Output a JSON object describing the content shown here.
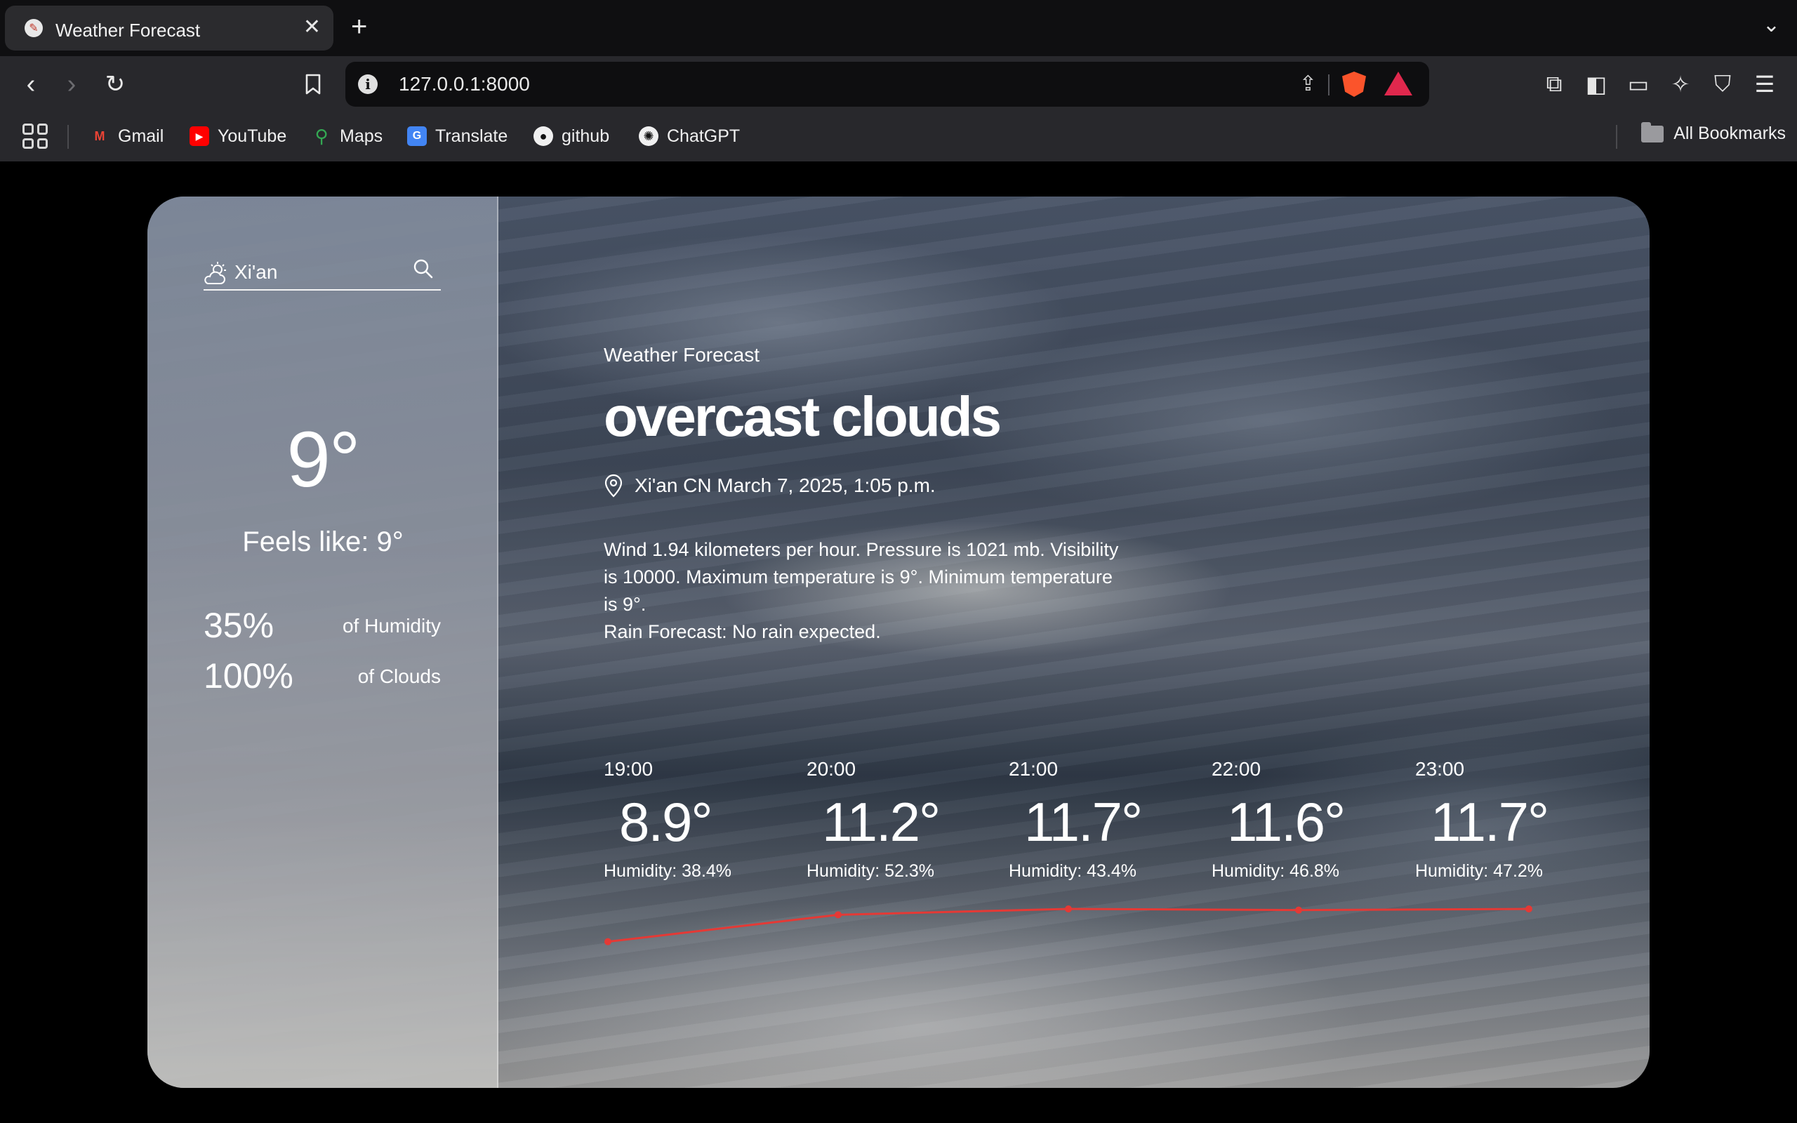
{
  "browser": {
    "tab_title": "Weather Forecast",
    "url": "127.0.0.1:8000",
    "bookmarks": [
      {
        "label": "Gmail"
      },
      {
        "label": "YouTube"
      },
      {
        "label": "Maps"
      },
      {
        "label": "Translate"
      },
      {
        "label": "github"
      },
      {
        "label": "ChatGPT"
      }
    ],
    "all_bookmarks": "All Bookmarks"
  },
  "sidebar": {
    "search_value": "Xi'an",
    "temperature": "9°",
    "feels_like": "Feels like:  9°",
    "humidity_value": "35%",
    "humidity_label": "of Humidity",
    "clouds_value": "100%",
    "clouds_label": "of Clouds"
  },
  "main": {
    "kicker": "Weather Forecast",
    "headline": "overcast clouds",
    "location_line": "Xi'an CN March 7, 2025, 1:05 p.m.",
    "description": [
      "Wind 1.94 kilometers per hour. Pressure is 1021 mb. Visibility is 10000. Maximum temperature is 9°. Minimum temperature is 9°.",
      "Rain Forecast: No rain expected."
    ]
  },
  "forecast": [
    {
      "time": "19:00",
      "temp": "8.9°",
      "humidity": "Humidity: 38.4%"
    },
    {
      "time": "20:00",
      "temp": "11.2°",
      "humidity": "Humidity: 52.3%"
    },
    {
      "time": "21:00",
      "temp": "11.7°",
      "humidity": "Humidity: 43.4%"
    },
    {
      "time": "22:00",
      "temp": "11.6°",
      "humidity": "Humidity: 46.8%"
    },
    {
      "time": "23:00",
      "temp": "11.7°",
      "humidity": "Humidity: 47.2%"
    }
  ],
  "chart_data": {
    "type": "line",
    "categories": [
      "19:00",
      "20:00",
      "21:00",
      "22:00",
      "23:00"
    ],
    "values": [
      8.9,
      11.2,
      11.7,
      11.6,
      11.7
    ],
    "ylim": [
      6,
      12.6
    ],
    "grid": false
  },
  "colors": {
    "trend_line": "#e53935",
    "page_background": "#000000"
  }
}
